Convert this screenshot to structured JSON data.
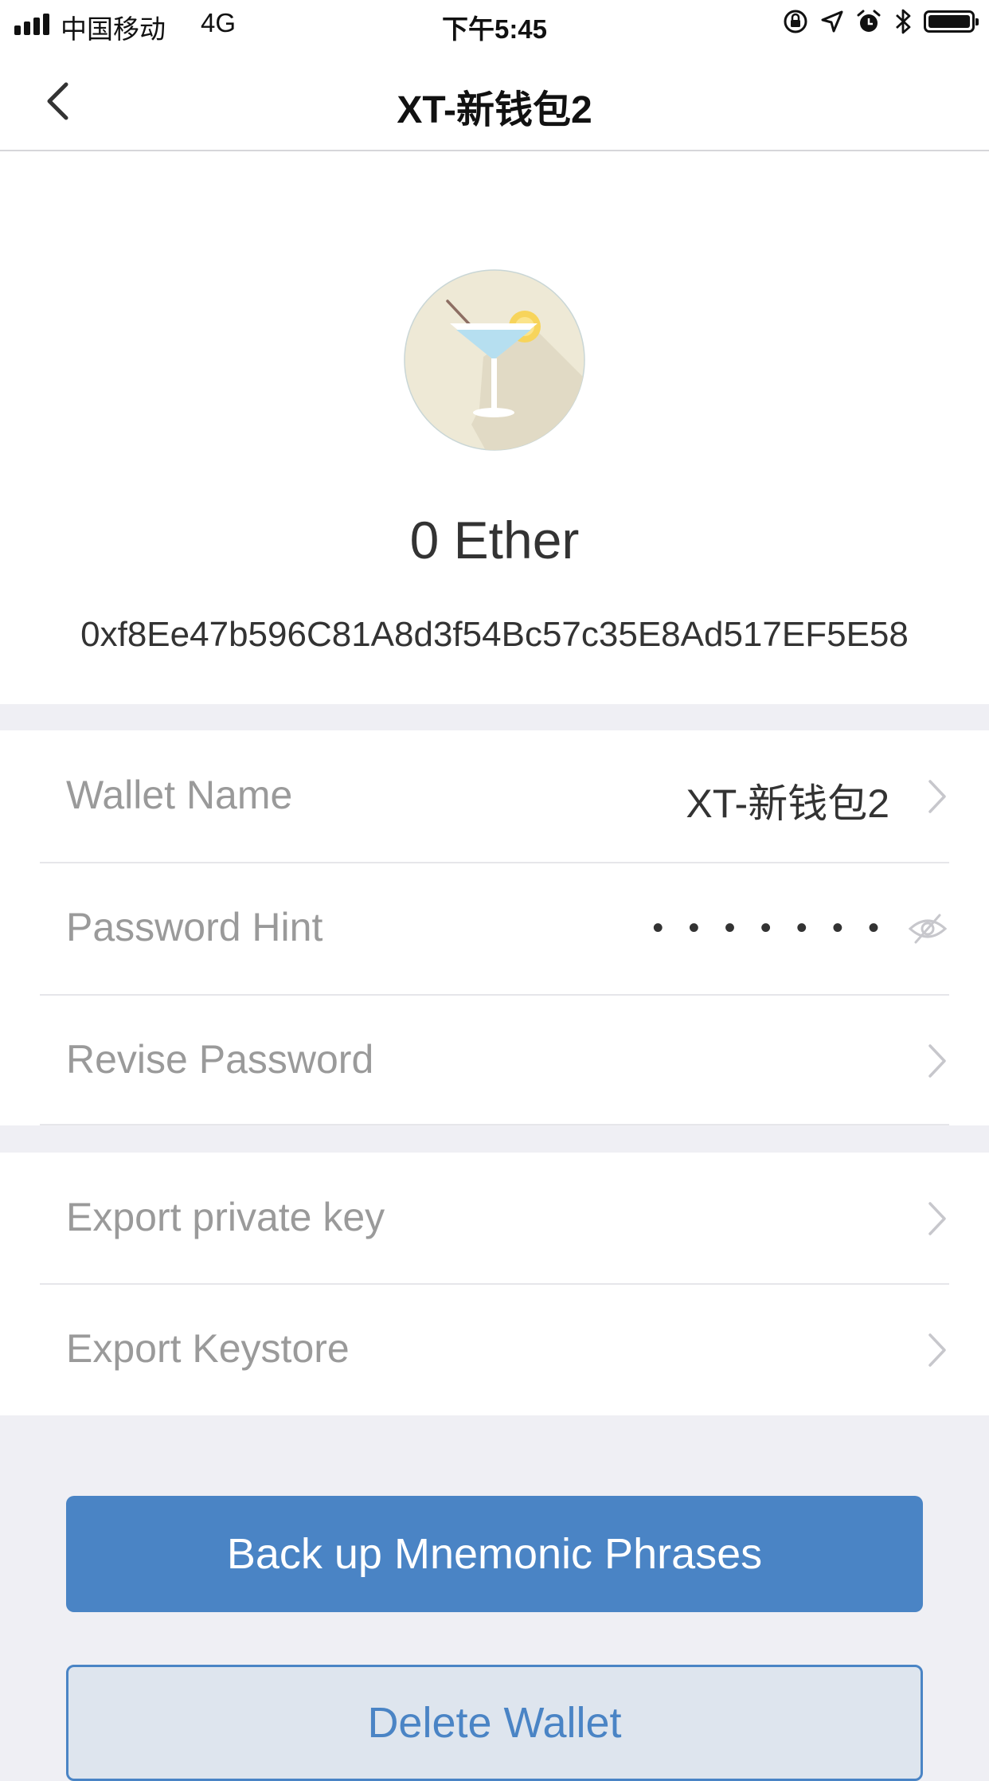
{
  "status_bar": {
    "carrier": "中国移动",
    "network": "4G",
    "time": "下午5:45",
    "icons": [
      "signal-icon",
      "orientation-lock-icon",
      "location-icon",
      "alarm-icon",
      "bluetooth-icon",
      "battery-icon"
    ]
  },
  "nav": {
    "title": "XT-新钱包2",
    "back_icon": "chevron-left-icon"
  },
  "wallet": {
    "avatar_icon": "cocktail-icon",
    "balance": "0 Ether",
    "address": "0xf8Ee47b596C81A8d3f54Bc57c35E8Ad517EF5E58"
  },
  "settings": {
    "wallet_name_label": "Wallet Name",
    "wallet_name_value": "XT-新钱包2",
    "password_hint_label": "Password Hint",
    "password_hint_value": "• • • • • • •",
    "revise_password_label": "Revise Password",
    "export_private_key_label": "Export private key",
    "export_keystore_label": "Export Keystore"
  },
  "actions": {
    "backup_label": "Back up Mnemonic Phrases",
    "delete_label": "Delete Wallet"
  },
  "colors": {
    "accent": "#4a84c5",
    "background": "#efeff4",
    "label_gray": "#9a9a9a"
  }
}
